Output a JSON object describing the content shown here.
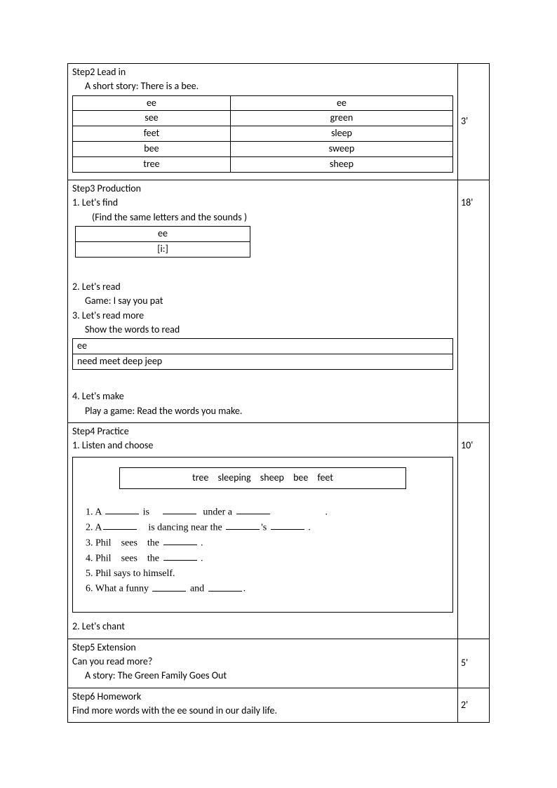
{
  "step2": {
    "title": "Step2 Lead in",
    "sub": "A short story: There is a bee.",
    "time": "3'",
    "table": {
      "rows": [
        [
          "ee",
          "ee"
        ],
        [
          "see",
          "green"
        ],
        [
          "feet",
          "sleep"
        ],
        [
          "bee",
          "sweep"
        ],
        [
          "tree",
          "sheep"
        ]
      ]
    }
  },
  "step3": {
    "title": "Step3 Production",
    "time": "18'",
    "p1_title": "1. Let's find",
    "p1_sub": "(Find the same letters and the sounds )",
    "p1_table": [
      "ee",
      "[i:]"
    ],
    "p2_title": "2. Let's read",
    "p2_sub": "Game:    I say you pat",
    "p3_title": "3. Let's read more",
    "p3_sub": "Show the words to read",
    "p3_row1": "ee",
    "p3_row2": "need    meet    deep    jeep",
    "p4_title": "4. Let's make",
    "p4_sub": "Play a game: Read the words you make."
  },
  "step4": {
    "title": "Step4 Practice",
    "time": "10'",
    "p1_title": "1. Listen and choose",
    "wordbank": "tree    sleeping    sheep    bee    feet",
    "fill": {
      "l1_a": "1. A ",
      "l1_b": " is",
      "l1_c": "under a ",
      "l1_d": ".",
      "l2_a": "2. A",
      "l2_b": "is dancing near the ",
      "l2_c": "'s ",
      "l2_d": ".",
      "l3_a": "3. Phil    sees    the ",
      "l3_b": ".",
      "l4_a": "4. Phil    sees    the ",
      "l4_b": ".",
      "l5": "5. Phil says to himself.",
      "l6_a": "6. What a funny ",
      "l6_b": " and ",
      "l6_c": "."
    },
    "p2_title": "2. Let's chant"
  },
  "step5": {
    "title": "Step5 Extension",
    "line1": "Can you read more?",
    "line2": "A story: The Green Family Goes Out",
    "time": "5'"
  },
  "step6": {
    "title": "Step6 Homework",
    "line1": "Find more words with the ee sound in our daily life.",
    "time": "2'"
  }
}
